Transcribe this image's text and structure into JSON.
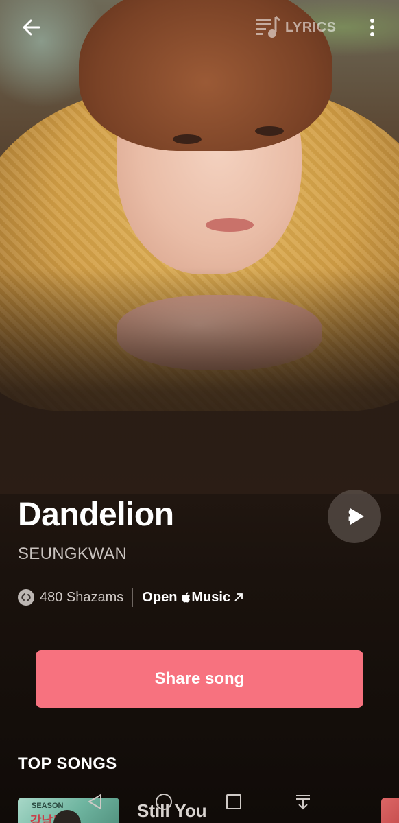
{
  "topbar": {
    "back_icon": "arrow-left-icon",
    "lyrics_label": "LYRICS",
    "lyrics_icon": "lyrics-icon",
    "more_icon": "more-vertical-icon"
  },
  "song": {
    "title": "Dandelion",
    "artist": "SEUNGKWAN",
    "play_tag": "CL\nPH"
  },
  "meta": {
    "shazam_count": "480 Shazams",
    "open_prefix": "Open",
    "open_service": "Music"
  },
  "actions": {
    "share_label": "Share song"
  },
  "top_songs": {
    "heading": "TOP SONGS",
    "items": [
      {
        "title": "Still You",
        "thumb_line1": "SEASON",
        "thumb_line2": "강남부"
      }
    ]
  },
  "colors": {
    "share_button": "#f7727f",
    "background": "#120d0a"
  },
  "navbar": {
    "icons": [
      "back-triangle-icon",
      "home-circle-icon",
      "recents-square-icon",
      "notifications-down-icon"
    ]
  }
}
